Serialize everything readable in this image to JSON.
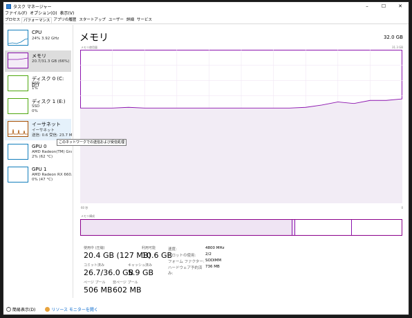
{
  "window": {
    "title": "タスク マネージャー",
    "controls": [
      "–",
      "☐",
      "✕"
    ]
  },
  "menu": [
    "ファイル(F)",
    "オプション(O)",
    "表示(V)"
  ],
  "tabs": [
    "プロセス",
    "パフォーマンス",
    "アプリの履歴",
    "スタートアップ",
    "ユーザー",
    "詳細",
    "サービス"
  ],
  "sidebar": [
    {
      "title": "CPU",
      "lines": [
        "24%  3.92 GHz"
      ],
      "color": "#117dbb"
    },
    {
      "title": "メモリ",
      "lines": [
        "20.7/31.3 GB (66%)"
      ],
      "color": "#8b12ae"
    },
    {
      "title": "ディスク 0 (C: D:)",
      "lines": [
        "SSD",
        "1%"
      ],
      "color": "#4da60c"
    },
    {
      "title": "ディスク 1 (E:)",
      "lines": [
        "SSD",
        "0%"
      ],
      "color": "#4da60c"
    },
    {
      "title": "イーサネット",
      "lines": [
        "イーサネット",
        "送信: 0.6  受信: 23.7 Mb"
      ],
      "color": "#a74f01"
    },
    {
      "title": "GPU 0",
      "lines": [
        "AMD Radeon(TM) Gra...",
        "2%  (62 °C)"
      ],
      "color": "#117dbb"
    },
    {
      "title": "GPU 1",
      "lines": [
        "AMD Radeon RX 660...",
        "0%  (47 °C)"
      ],
      "color": "#117dbb"
    }
  ],
  "tooltip": "このネットワークでの送信および受信処理",
  "main": {
    "title": "メモリ",
    "total": "32.0 GB",
    "graph_label_left": "メモリ使用量",
    "graph_label_right": "31.3 GB",
    "axis_left": "60 秒",
    "axis_right": "0",
    "composition_label": "メモリ構成",
    "line_color": "#8b12ae",
    "usage_series": [
      0.62,
      0.62,
      0.62,
      0.625,
      0.62,
      0.62,
      0.62,
      0.62,
      0.62,
      0.62,
      0.62,
      0.62,
      0.62,
      0.62,
      0.625,
      0.64,
      0.66,
      0.65,
      0.67,
      0.67,
      0.68
    ]
  },
  "stats": [
    {
      "label": "使用中 (圧縮)",
      "value": "20.4 GB (127 MB)"
    },
    {
      "label": "利用可能",
      "value": "10.6 GB"
    },
    {
      "label": "コミット済み",
      "value": "26.7/36.0 GB"
    },
    {
      "label": "キャッシュ済み",
      "value": "5.9 GB"
    },
    {
      "label": "ページ プール",
      "value": "506 MB"
    },
    {
      "label": "非ページ プール",
      "value": "602 MB"
    }
  ],
  "info": [
    {
      "k": "速度:",
      "v": "4800 MHz"
    },
    {
      "k": "スロットの使用:",
      "v": "2/2"
    },
    {
      "k": "フォーム ファクター:",
      "v": "SODIMM"
    },
    {
      "k": "ハードウェア予約済み:",
      "v": "736 MB"
    }
  ],
  "footer": {
    "less": "簡易表示(D)",
    "resmon": "リソース モニターを開く"
  }
}
